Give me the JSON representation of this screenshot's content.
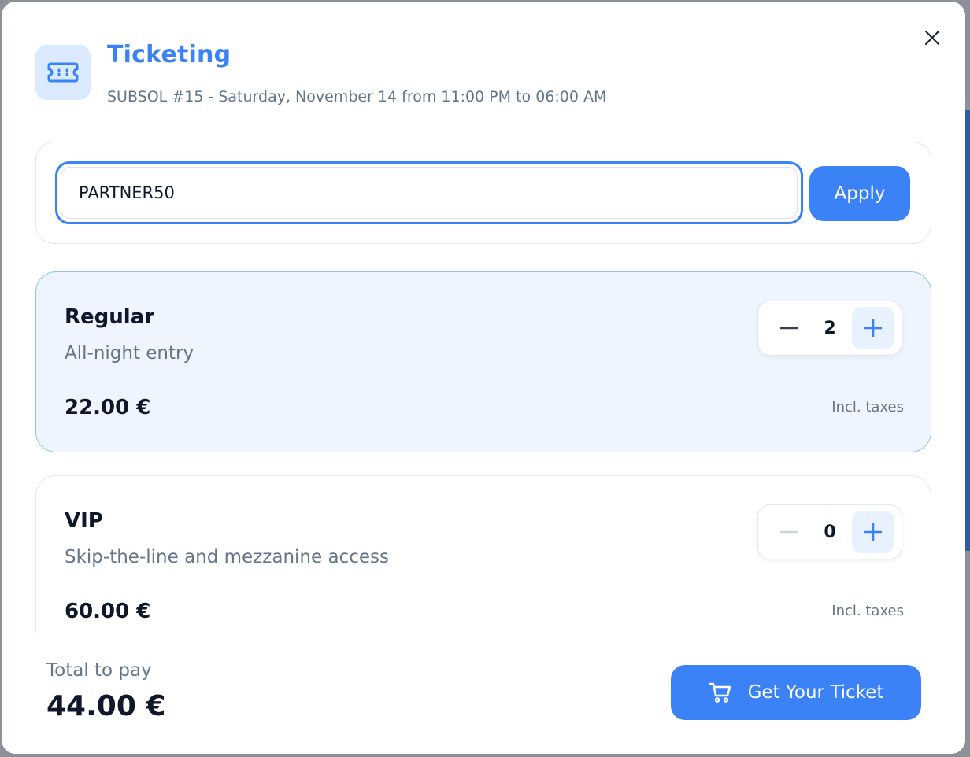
{
  "header": {
    "title": "Ticketing",
    "subtitle": "SUBSOL #15 - Saturday, November 14 from 11:00 PM to 06:00 AM",
    "icon": "ticket-icon"
  },
  "promo": {
    "value": "PARTNER50",
    "apply_label": "Apply"
  },
  "tickets": [
    {
      "name": "Regular",
      "description": "All-night entry",
      "price": "22.00 €",
      "tax_note": "Incl. taxes",
      "quantity": "2",
      "selected": true
    },
    {
      "name": "VIP",
      "description": "Skip-the-line and mezzanine access",
      "price": "60.00 €",
      "tax_note": "Incl. taxes",
      "quantity": "0",
      "selected": false
    }
  ],
  "footer": {
    "total_label": "Total to pay",
    "total_amount": "44.00 €",
    "cta_label": "Get Your Ticket",
    "cta_icon": "cart-icon"
  },
  "colors": {
    "accent": "#3b82f6",
    "selected_card_bg": "#eef5fe",
    "selected_card_border": "#8fc3ee",
    "muted_text": "#64748b"
  }
}
